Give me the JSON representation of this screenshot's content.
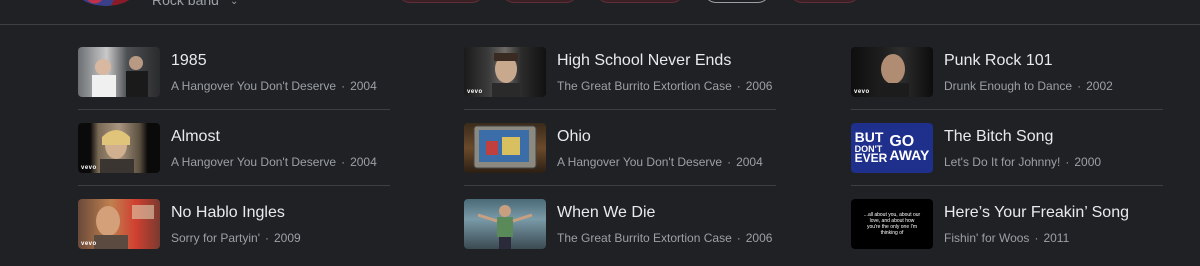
{
  "header": {
    "artist_type": "Rock band"
  },
  "songs": [
    {
      "title": "1985",
      "album": "A Hangover You Don't Deserve",
      "year": "2004",
      "thumb_icon": "music-video-thumbnail"
    },
    {
      "title": "High School Never Ends",
      "album": "The Great Burrito Extortion Case",
      "year": "2006",
      "thumb_icon": "music-video-thumbnail"
    },
    {
      "title": "Punk Rock 101",
      "album": "Drunk Enough to Dance",
      "year": "2002",
      "thumb_icon": "music-video-thumbnail"
    },
    {
      "title": "Almost",
      "album": "A Hangover You Don't Deserve",
      "year": "2004",
      "thumb_icon": "music-video-thumbnail"
    },
    {
      "title": "Ohio",
      "album": "A Hangover You Don't Deserve",
      "year": "2004",
      "thumb_icon": "music-video-thumbnail"
    },
    {
      "title": "The Bitch Song",
      "album": "Let's Do It for Johnny!",
      "year": "2000",
      "thumb_icon": "album-art-thumbnail"
    },
    {
      "title": "No Hablo Ingles",
      "album": "Sorry for Partyin'",
      "year": "2009",
      "thumb_icon": "music-video-thumbnail"
    },
    {
      "title": "When We Die",
      "album": "The Great Burrito Extortion Case",
      "year": "2006",
      "thumb_icon": "music-video-thumbnail"
    },
    {
      "title": "Here’s Your Freakin’ Song",
      "album": "Fishin' for Woos",
      "year": "2011",
      "thumb_icon": "lyrics-thumbnail"
    }
  ],
  "thumb_labels": {
    "vevo": "vevo",
    "bitch_song_art": [
      "BUT",
      "DON'T",
      "GO",
      "EVER",
      "AWAY"
    ],
    "lyrics_art": "...all about you, about our love, and about how you're the only one I'm thinking of"
  },
  "separator": "·"
}
